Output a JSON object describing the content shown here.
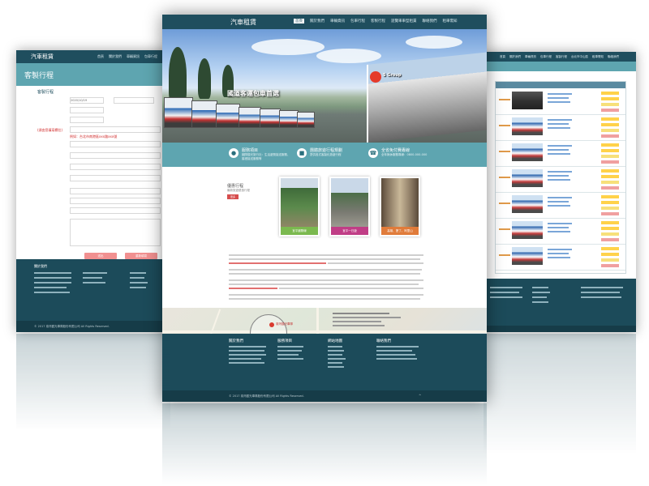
{
  "brand": "汽車租賃",
  "left_page": {
    "nav": [
      "首頁",
      "關於我們",
      "車輛資訊",
      "包車行程",
      "客製行程"
    ],
    "banner_title": "客製行程",
    "form_heading": "客製行程",
    "date_value": "2020/10/19",
    "required_note": "(須由您填寫欄位)",
    "red_note": "例如：台北市南港區xxx路xxx號",
    "submit_label": "送出",
    "reset_label": "重新填寫",
    "footer_heading": "關於我們",
    "copyright": "© 2017 臺灣觀光車隊股份有限公司 All Rights Reserved."
  },
  "right_page": {
    "nav": [
      "首頁",
      "關於我們",
      "車輛資訊",
      "包車行程",
      "客製行程",
      "台北市中山區",
      "租車需知",
      "聯絡我們"
    ]
  },
  "center_page": {
    "nav": [
      "首頁",
      "關於我們",
      "車輛資訊",
      "包車行程",
      "客製行程",
      "遊覽車車型租賃",
      "聯絡我們",
      "租車需知"
    ],
    "hero_title": "國道客運包車首選",
    "hero_logo_text": "S Group",
    "features": [
      {
        "icon": "user-icon",
        "title": "服務項目",
        "desc": "國際觀光旅行社：生活遊覽接送服務、婚禮接送服務等"
      },
      {
        "icon": "bus-icon",
        "title": "團體旅遊行程規劃",
        "desc": "提供各式客製化旅遊行程"
      },
      {
        "icon": "phone-icon",
        "title": "全省免付費專線",
        "desc": "全年無休服務專線：0800-000-000"
      }
    ],
    "tours_heading": "優惠行程",
    "tours_tag": "最新旅遊優惠行程",
    "more_label": "更多",
    "tours": [
      {
        "caption": "宜平國際線",
        "color": "#7bb94f"
      },
      {
        "caption": "宜平一日遊",
        "color": "#c03d86"
      },
      {
        "caption": "高雄、墾丁、阿里山",
        "color": "#e07b3a"
      }
    ],
    "map_label": "臺灣觀光車隊",
    "footer_cols": [
      "關於我們",
      "服務項目",
      "網站地圖",
      "聯絡我們"
    ],
    "copyright": "© 2017 臺灣觀光車隊股份有限公司 All Rights Reserved."
  }
}
